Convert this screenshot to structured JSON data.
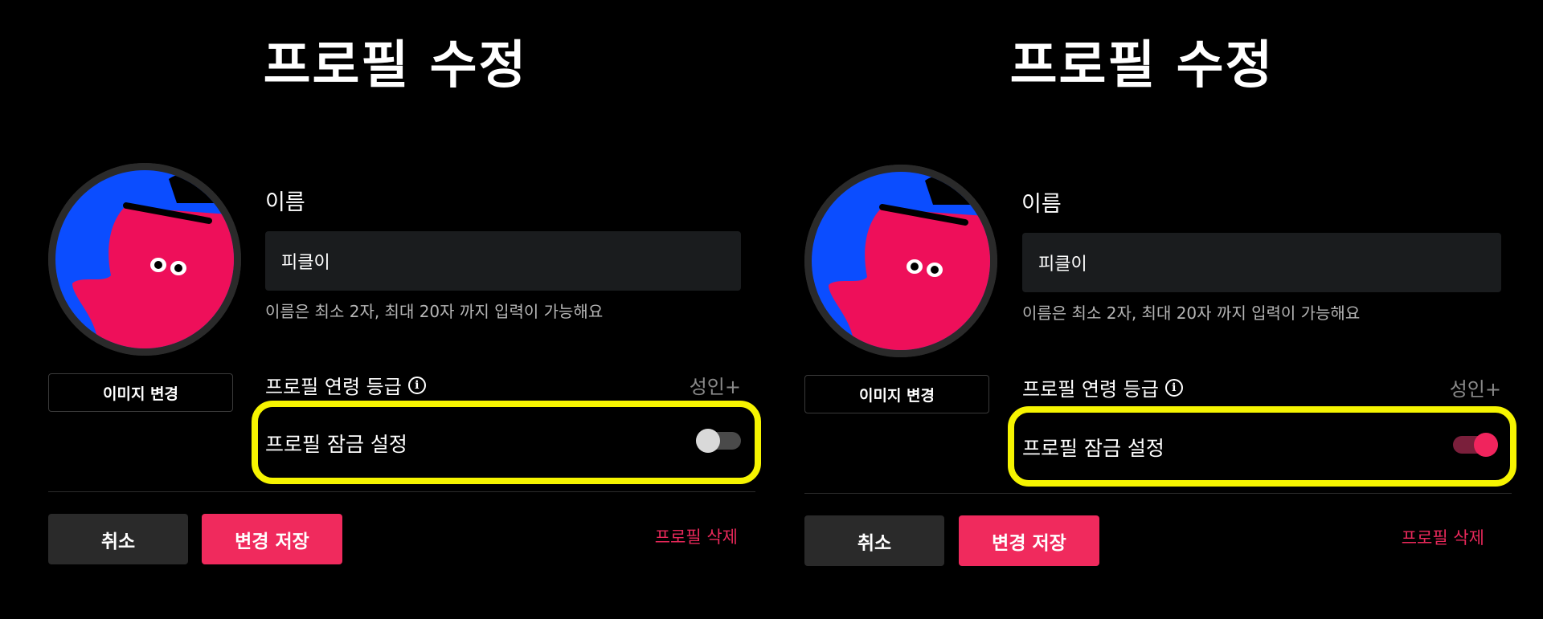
{
  "panels": [
    {
      "title": "프로필 수정",
      "change_image_label": "이미지 변경",
      "name_label": "이름",
      "name_value": "피클이",
      "name_hint": "이름은 최소 2자, 최대 20자 까지 입력이 가능해요",
      "age_rating_label": "프로필 연령 등급",
      "age_rating_value": "성인+",
      "lock_label": "프로필 잠금 설정",
      "lock_enabled": false,
      "cancel_label": "취소",
      "save_label": "변경 저장",
      "delete_label": "프로필 삭제"
    },
    {
      "title": "프로필 수정",
      "change_image_label": "이미지 변경",
      "name_label": "이름",
      "name_value": "피클이",
      "name_hint": "이름은 최소 2자, 최대 20자 까지 입력이 가능해요",
      "age_rating_label": "프로필 연령 등급",
      "age_rating_value": "성인+",
      "lock_label": "프로필 잠금 설정",
      "lock_enabled": true,
      "cancel_label": "취소",
      "save_label": "변경 저장",
      "delete_label": "프로필 삭제"
    }
  ],
  "colors": {
    "background": "#000000",
    "accent": "#f02a5d",
    "highlight": "#f6f400",
    "input_bg": "#1a1c1e",
    "avatar_blue": "#0b4dff",
    "avatar_pink": "#ee0f5a"
  },
  "icons": {
    "info": "info-icon",
    "avatar": "pickle-character-avatar"
  }
}
